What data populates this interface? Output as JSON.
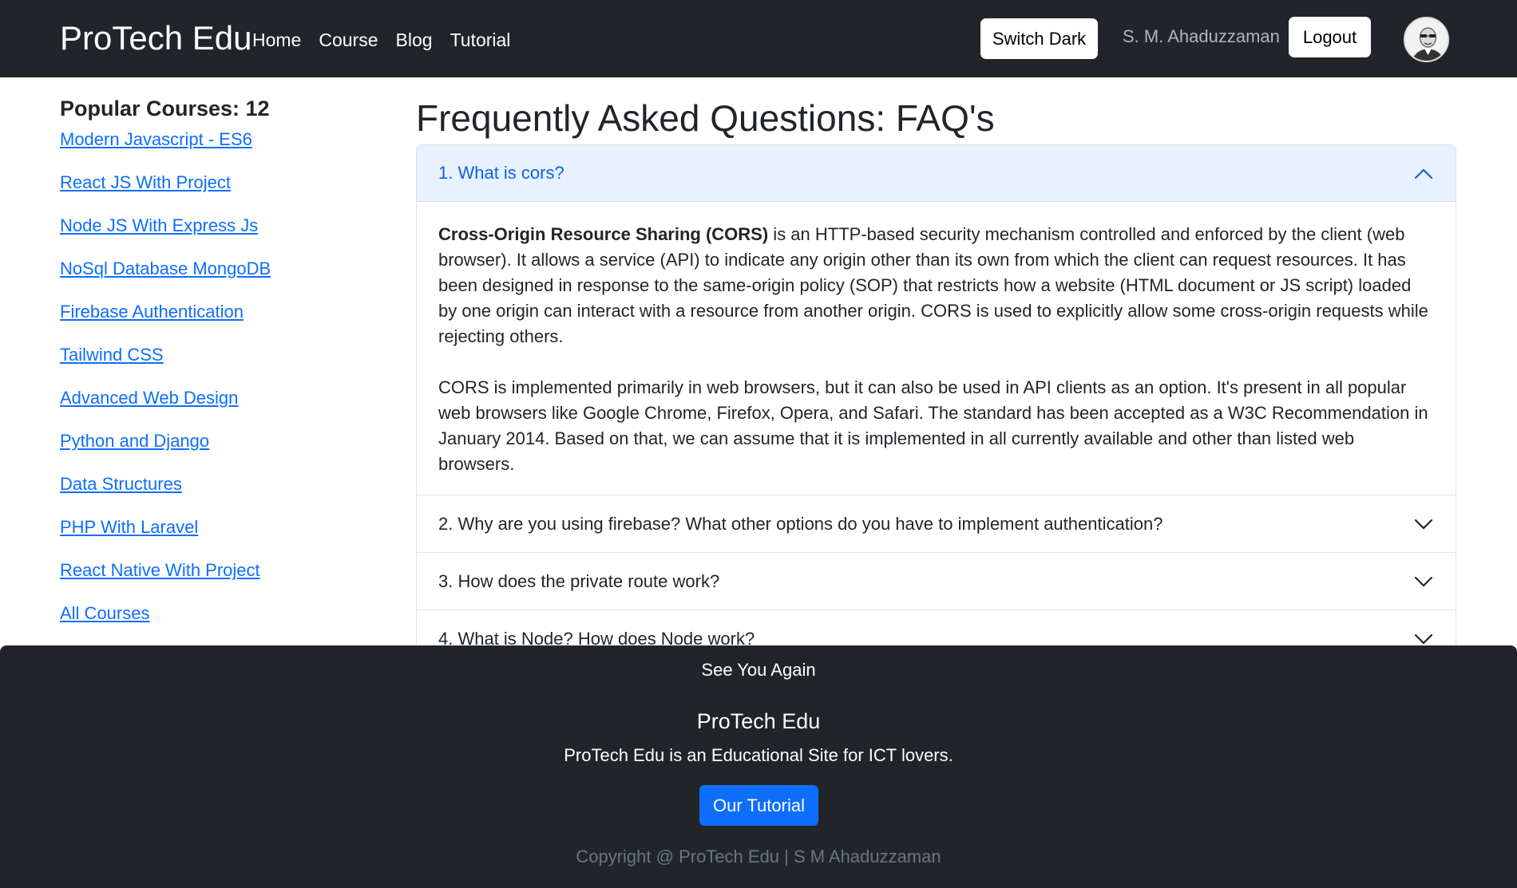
{
  "navbar": {
    "brand": "ProTech Edu",
    "links": [
      "Home",
      "Course",
      "Blog",
      "Tutorial"
    ],
    "switch_label": "Switch Dark",
    "user_name": "S. M. Ahaduzzaman",
    "logout_label": "Logout"
  },
  "sidebar": {
    "title": "Popular Courses: 12",
    "courses": [
      "Modern Javascript - ES6",
      "React JS With Project",
      "Node JS With Express Js",
      "NoSql Database MongoDB",
      "Firebase Authentication",
      "Tailwind CSS",
      "Advanced Web Design",
      "Python and Django",
      "Data Structures",
      "PHP With Laravel",
      "React Native With Project",
      "All Courses"
    ]
  },
  "faq": {
    "title": "Frequently Asked Questions: FAQ's",
    "items": [
      {
        "question": "1. What is cors?",
        "expanded": true,
        "answer_bold": "Cross-Origin Resource Sharing (CORS)",
        "answer_rest": " is an HTTP-based security mechanism controlled and enforced by the client (web browser). It allows a service (API) to indicate any origin other than its own from which the client can request resources. It has been designed in response to the same-origin policy (SOP) that restricts how a website (HTML document or JS script) loaded by one origin can interact with a resource from another origin. CORS is used to explicitly allow some cross-origin requests while rejecting others.",
        "answer_p2": "CORS is implemented primarily in web browsers, but it can also be used in API clients as an option. It's present in all popular web browsers like Google Chrome, Firefox, Opera, and Safari. The standard has been accepted as a W3C Recommendation in January 2014. Based on that, we can assume that it is implemented in all currently available and other than listed web browsers."
      },
      {
        "question": "2. Why are you using firebase? What other options do you have to implement authentication?",
        "expanded": false
      },
      {
        "question": "3. How does the private route work?",
        "expanded": false
      },
      {
        "question": "4. What is Node? How does Node work?",
        "expanded": false
      }
    ]
  },
  "footer": {
    "tagline": "See You Again",
    "brand": "ProTech Edu",
    "description": "ProTech Edu is an Educational Site for ICT lovers.",
    "button_label": "Our Tutorial",
    "copyright": "Copyright @ ProTech Edu | S M Ahaduzzaman"
  },
  "colors": {
    "navbar_bg": "#212529",
    "link": "#0d6efd",
    "accordion_open_bg": "#e7f1ff",
    "primary_button": "#0d6efd",
    "muted": "#6c757d"
  }
}
